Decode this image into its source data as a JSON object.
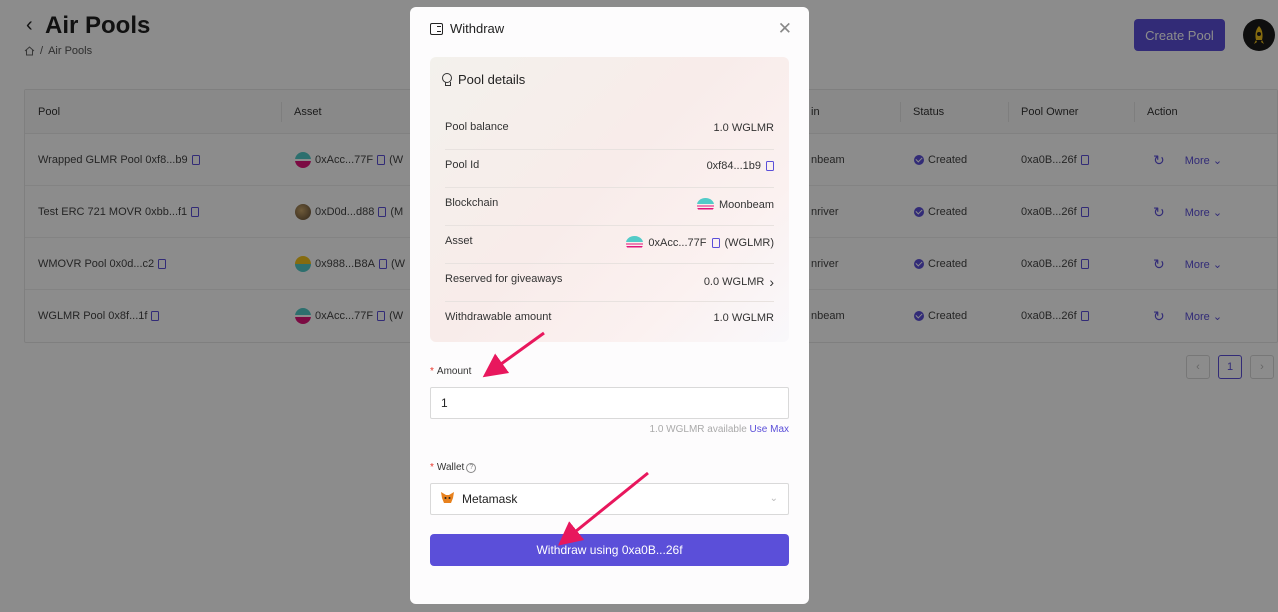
{
  "page": {
    "title": "Air Pools",
    "breadcrumb": "Air Pools",
    "create_button": "Create Pool"
  },
  "table": {
    "headers": [
      "Pool",
      "Asset",
      "in",
      "Status",
      "Pool Owner",
      "Action"
    ],
    "rows": [
      {
        "pool": "Wrapped GLMR Pool 0xf8...b9",
        "asset": "0xAcc...77F",
        "asset_tail": "(W",
        "chain": "nbeam",
        "status": "Created",
        "owner": "0xa0B...26f",
        "action": "More"
      },
      {
        "pool": "Test ERC 721 MOVR 0xbb...f1",
        "asset": "0xD0d...d88",
        "asset_tail": "(M",
        "chain": "nriver",
        "status": "Created",
        "owner": "0xa0B...26f",
        "action": "More"
      },
      {
        "pool": "WMOVR Pool 0x0d...c2",
        "asset": "0x988...B8A",
        "asset_tail": "(W",
        "chain": "nriver",
        "status": "Created",
        "owner": "0xa0B...26f",
        "action": "More"
      },
      {
        "pool": "WGLMR Pool 0x8f...1f",
        "asset": "0xAcc...77F",
        "asset_tail": "(W",
        "chain": "nbeam",
        "status": "Created",
        "owner": "0xa0B...26f",
        "action": "More"
      }
    ],
    "page_number": "1"
  },
  "modal": {
    "title": "Withdraw",
    "details_title": "Pool details",
    "details": {
      "pool_balance_label": "Pool balance",
      "pool_balance": "1.0  WGLMR",
      "pool_id_label": "Pool Id",
      "pool_id": "0xf84...1b9",
      "blockchain_label": "Blockchain",
      "blockchain": "Moonbeam",
      "asset_label": "Asset",
      "asset": "0xAcc...77F",
      "asset_symbol": "(WGLMR)",
      "reserved_label": "Reserved for giveaways",
      "reserved": "0.0  WGLMR",
      "withdrawable_label": "Withdrawable amount",
      "withdrawable": "1.0  WGLMR"
    },
    "amount_label": "Amount",
    "amount_value": "1",
    "available_text": "1.0 WGLMR available",
    "use_max": "Use Max",
    "wallet_label": "Wallet",
    "wallet_value": "Metamask",
    "withdraw_button": "Withdraw using 0xa0B...26f"
  },
  "colors": {
    "accent": "#5b4fd9",
    "annotation_arrow": "#e8175d"
  }
}
